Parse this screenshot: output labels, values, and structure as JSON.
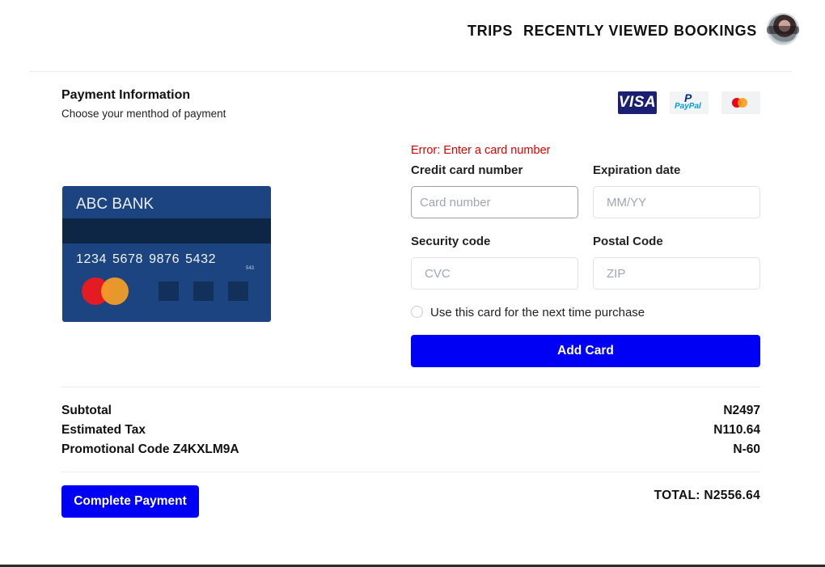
{
  "nav": {
    "links": [
      "TRIPS",
      "RECENTLY VIEWED",
      "BOOKINGS"
    ]
  },
  "payment": {
    "title": "Payment Information",
    "subtitle": "Choose your menthod of payment",
    "logos": {
      "visa": "VISA",
      "paypal_p": "P",
      "paypal_text": "PayPal"
    }
  },
  "card_preview": {
    "bank": "ABC BANK",
    "number": "1234 5678 9876 5432",
    "cvc": "543"
  },
  "form": {
    "error": "Error: Enter a card number",
    "card_number_label": "Credit card number",
    "card_number_placeholder": "Card number",
    "card_number_value": "",
    "expiration_label": "Expiration date",
    "expiration_placeholder": "MM/YY",
    "security_label": "Security code",
    "security_placeholder": "CVC",
    "postal_label": "Postal Code",
    "postal_placeholder": "ZIP",
    "save_card_label": "Use this card for the next time purchase",
    "save_card_checked": false,
    "add_card_button": "Add Card"
  },
  "summary": {
    "rows": [
      {
        "label": "Subtotal",
        "value": "N2497"
      },
      {
        "label": "Estimated Tax",
        "value": "N110.64"
      },
      {
        "label": "Promotional Code Z4KXLM9A",
        "value": "N-60"
      }
    ],
    "complete_button": "Complete Payment",
    "total": "TOTAL: N2556.64"
  },
  "colors": {
    "primary_button": "#0000f5",
    "error": "#e00000",
    "card_background": "#1c4480",
    "visa_background": "#1a1f71"
  }
}
